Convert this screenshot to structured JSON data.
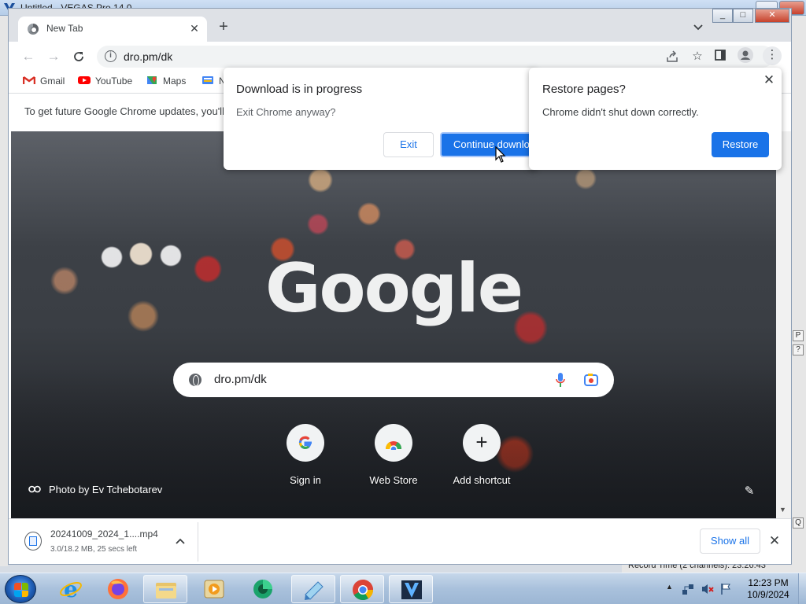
{
  "vegas": {
    "title": "Untitled - VEGAS Pro 14.0",
    "record_time": "Record Time (2 channels): 23:26:43",
    "side_buttons": [
      "P",
      "?",
      "Q"
    ]
  },
  "chrome": {
    "tab": {
      "title": "New Tab",
      "close": "✕"
    },
    "new_tab": "+",
    "tab_search": "⌄",
    "url": "dro.pm/dk",
    "bookmarks": [
      {
        "label": "Gmail",
        "icon": "gmail-icon"
      },
      {
        "label": "YouTube",
        "icon": "youtube-icon"
      },
      {
        "label": "Maps",
        "icon": "maps-icon"
      },
      {
        "label": "N",
        "icon": "news-icon"
      }
    ],
    "infobar": "To get future Google Chrome updates, you'll",
    "ntp": {
      "logo": "Google",
      "search_value": "dro.pm/dk",
      "shortcuts": [
        {
          "label": "Sign in",
          "icon": "google-g-icon"
        },
        {
          "label": "Web Store",
          "icon": "chrome-web-store-icon"
        },
        {
          "label": "Add shortcut",
          "icon": "plus-icon"
        }
      ],
      "photo_credit": "Photo by Ev Tchebotarev"
    },
    "download": {
      "filename": "20241009_2024_1....mp4",
      "status": "3.0/18.2 MB, 25 secs left",
      "show_all": "Show all"
    }
  },
  "dialog_download": {
    "title": "Download is in progress",
    "body": "Exit Chrome anyway?",
    "exit": "Exit",
    "continue": "Continue download"
  },
  "dialog_restore": {
    "title": "Restore pages?",
    "body": "Chrome didn't shut down correctly.",
    "restore": "Restore"
  },
  "taskbar": {
    "time": "12:23 PM",
    "date": "10/9/2024",
    "items": [
      "Internet Explorer",
      "Firefox",
      "File Explorer",
      "Media Player",
      "Camtasia",
      "Notepad",
      "Google Chrome",
      "VEGAS Pro"
    ]
  },
  "colors": {
    "accent": "#1a73e8",
    "taskbar": "#a9c1dc"
  }
}
